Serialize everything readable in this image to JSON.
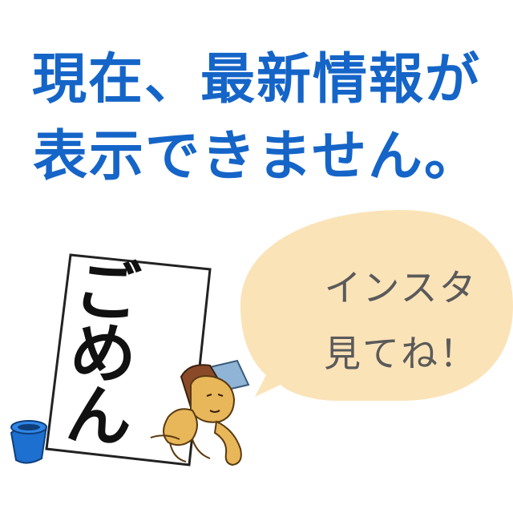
{
  "message": {
    "line1": "現在、最新情報が",
    "line2": "表示できません。"
  },
  "speech_bubble": {
    "line1": "インスタ",
    "line2": "見てね！"
  },
  "sign": {
    "char1": "ご",
    "char2": "め",
    "char3": "ん"
  },
  "icons": {
    "bucket": "bucket-icon",
    "character": "mascot-character-icon"
  },
  "colors": {
    "headline": "#1565c8",
    "bubble_fill": "#fbe3b8",
    "bubble_text": "#5a5a5a",
    "bucket": "#1d6fd0"
  }
}
